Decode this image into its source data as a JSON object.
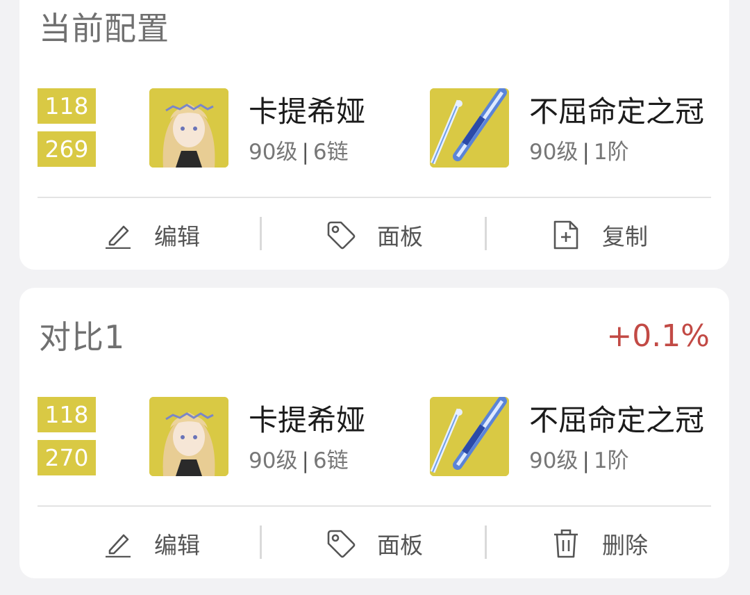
{
  "cards": [
    {
      "title": "当前配置",
      "stats": [
        "118",
        "269"
      ],
      "character": {
        "name": "卡提希娅",
        "level": "90级",
        "chain": "6链"
      },
      "weapon": {
        "name": "不屈命定之冠",
        "level": "90级",
        "rank": "1阶"
      },
      "actions": [
        {
          "label": "编辑",
          "icon": "pencil-icon"
        },
        {
          "label": "面板",
          "icon": "tag-icon"
        },
        {
          "label": "复制",
          "icon": "file-plus-icon"
        }
      ]
    },
    {
      "title": "对比1",
      "percent": "+0.1%",
      "stats": [
        "118",
        "270"
      ],
      "character": {
        "name": "卡提希娅",
        "level": "90级",
        "chain": "6链"
      },
      "weapon": {
        "name": "不屈命定之冠",
        "level": "90级",
        "rank": "1阶"
      },
      "actions": [
        {
          "label": "编辑",
          "icon": "pencil-icon"
        },
        {
          "label": "面板",
          "icon": "tag-icon"
        },
        {
          "label": "删除",
          "icon": "trash-icon"
        }
      ]
    }
  ],
  "colors": {
    "stat_bg": "#d9c944",
    "percent": "#c24a45",
    "card_bg": "#ffffff",
    "page_bg": "#f2f2f4"
  }
}
